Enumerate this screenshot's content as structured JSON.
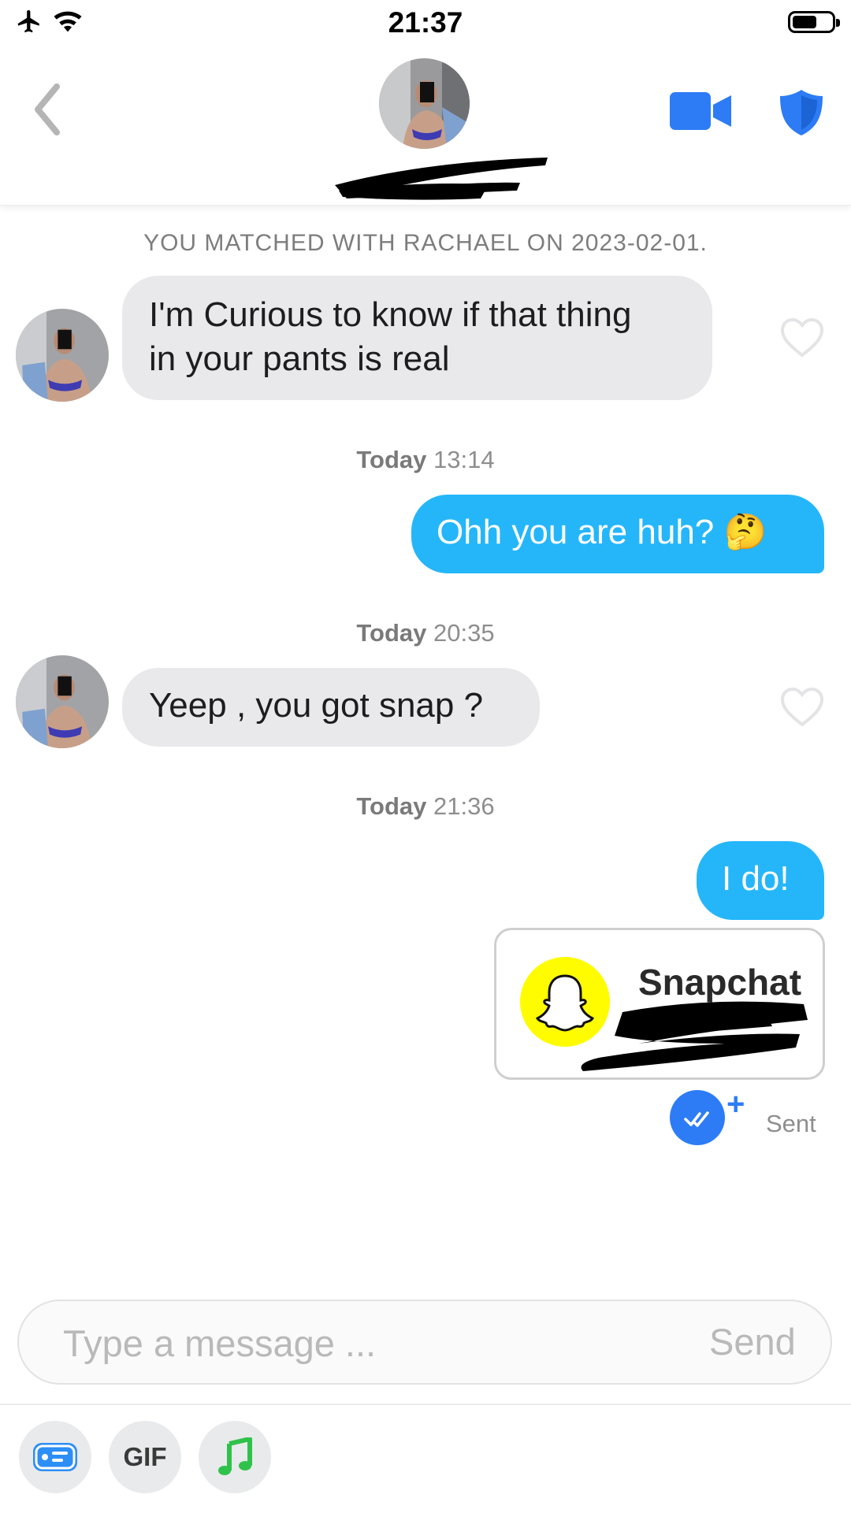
{
  "status_bar": {
    "time": "21:37"
  },
  "header": {
    "back_icon": "chevron-left-icon",
    "video_icon": "video-camera-icon",
    "safety_icon": "shield-icon"
  },
  "system_message": "YOU MATCHED WITH RACHAEL ON 2023-02-01.",
  "messages": [
    {
      "type": "in",
      "text_line1": "I'm Curious to know if that thing",
      "text_line2": "in your pants is real"
    },
    {
      "timestamp_day": "Today",
      "timestamp_time": "13:14"
    },
    {
      "type": "out",
      "text": "Ohh you are huh? 🤔"
    },
    {
      "timestamp_day": "Today",
      "timestamp_time": "20:35"
    },
    {
      "type": "in",
      "text": "Yeep , you got snap ?"
    },
    {
      "timestamp_day": "Today",
      "timestamp_time": "21:36"
    },
    {
      "type": "out",
      "text": "I do!"
    },
    {
      "type": "card",
      "title": "Snapchat"
    }
  ],
  "receipt": {
    "plus": "+",
    "label": "Sent"
  },
  "composer": {
    "placeholder": "Type a message ...",
    "send_label": "Send"
  },
  "toolbar": {
    "gif_label": "GIF",
    "colors": {
      "accent_blue": "#25b6fa",
      "icon_blue": "#2d7cf6",
      "music_green": "#2fc24b",
      "snap_yellow": "#fffc00"
    }
  }
}
